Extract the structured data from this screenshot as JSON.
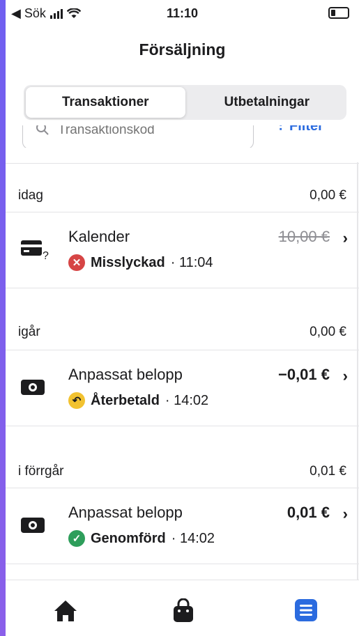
{
  "status_bar": {
    "back_label": "◀ Sök",
    "time": "11:10"
  },
  "header": {
    "title": "Försäljning"
  },
  "segments": [
    {
      "label": "Transaktioner",
      "active": true
    },
    {
      "label": "Utbetalningar",
      "active": false
    }
  ],
  "search": {
    "placeholder": "Transaktionskod"
  },
  "filter": {
    "label": "Filter"
  },
  "sections": [
    {
      "label": "idag",
      "total": "0,00 €",
      "items": [
        {
          "name": "Kalender",
          "amount": "10,00 €",
          "status": "Misslyckad",
          "time": "· 11:04",
          "icon": "card-question-icon",
          "status_icon": "failed-icon"
        }
      ]
    },
    {
      "label": "igår",
      "total": "0,00 €",
      "items": [
        {
          "name": "Anpassat belopp",
          "amount": "−0,01 €",
          "status": "Återbetald",
          "time": "· 14:02",
          "icon": "cash-icon",
          "status_icon": "refund-icon"
        }
      ]
    },
    {
      "label": "i förrgår",
      "total": "0,01 €",
      "items": [
        {
          "name": "Anpassat belopp",
          "amount": "0,01 €",
          "status": "Genomförd",
          "time": "· 14:02",
          "icon": "cash-icon",
          "status_icon": "completed-icon"
        }
      ]
    }
  ],
  "tabbar": {
    "items": [
      "home-icon",
      "shop-bag-icon",
      "list-icon"
    ],
    "active": "list-icon"
  },
  "colors": {
    "accent": "#2b6bdf",
    "failed": "#d64545",
    "refunded": "#f2c230",
    "completed": "#2e9e5b"
  }
}
